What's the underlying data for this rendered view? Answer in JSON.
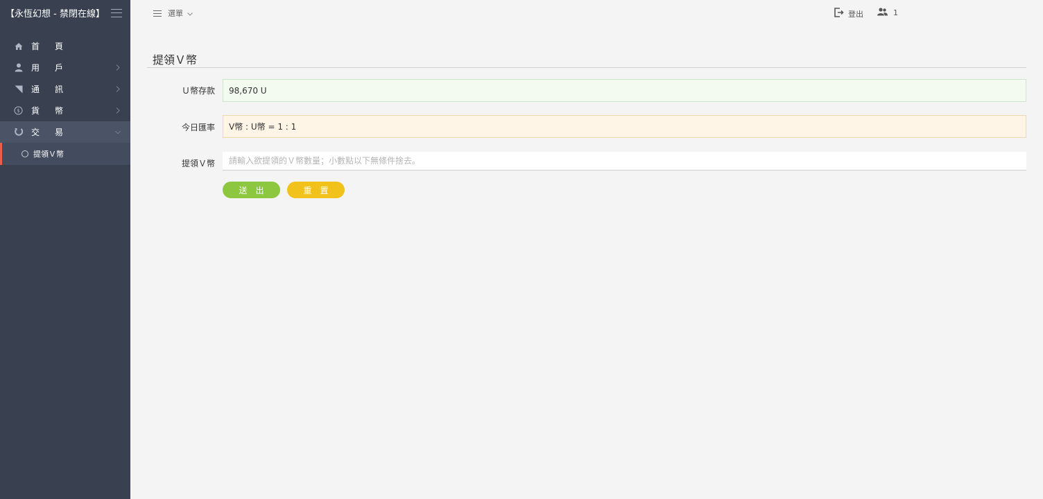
{
  "sidebar": {
    "brand": "【永恆幻想 - 禁閉在線】",
    "items": [
      {
        "label": "首頁",
        "icon": "home-icon"
      },
      {
        "label": "用戶",
        "icon": "user-icon"
      },
      {
        "label": "通訊",
        "icon": "signal-icon"
      },
      {
        "label": "貨幣",
        "icon": "currency-icon"
      },
      {
        "label": "交易",
        "icon": "transaction-icon"
      }
    ],
    "subitems": [
      {
        "label": "提領Ｖ幣"
      }
    ]
  },
  "topbar": {
    "menu_label": "選單",
    "logout_label": "登出",
    "user_count": "1"
  },
  "main": {
    "title": "提領Ｖ幣",
    "form": {
      "balance_label": "Ｕ幣存款",
      "balance_value": "98,670 U",
      "rate_label": "今日匯率",
      "rate_value": "V幣 : U幣 = 1 : 1",
      "withdraw_label": "提領Ｖ幣",
      "withdraw_placeholder": "請輸入欲提領的Ｖ幣數量；小數點以下無條件捨去。"
    },
    "buttons": {
      "submit": "送出",
      "reset": "重置"
    }
  },
  "colors": {
    "sidebar_bg": "#394150",
    "active_accent": "#f05b4f",
    "submit_button": "#8dc63f",
    "reset_button": "#f1c21b"
  }
}
